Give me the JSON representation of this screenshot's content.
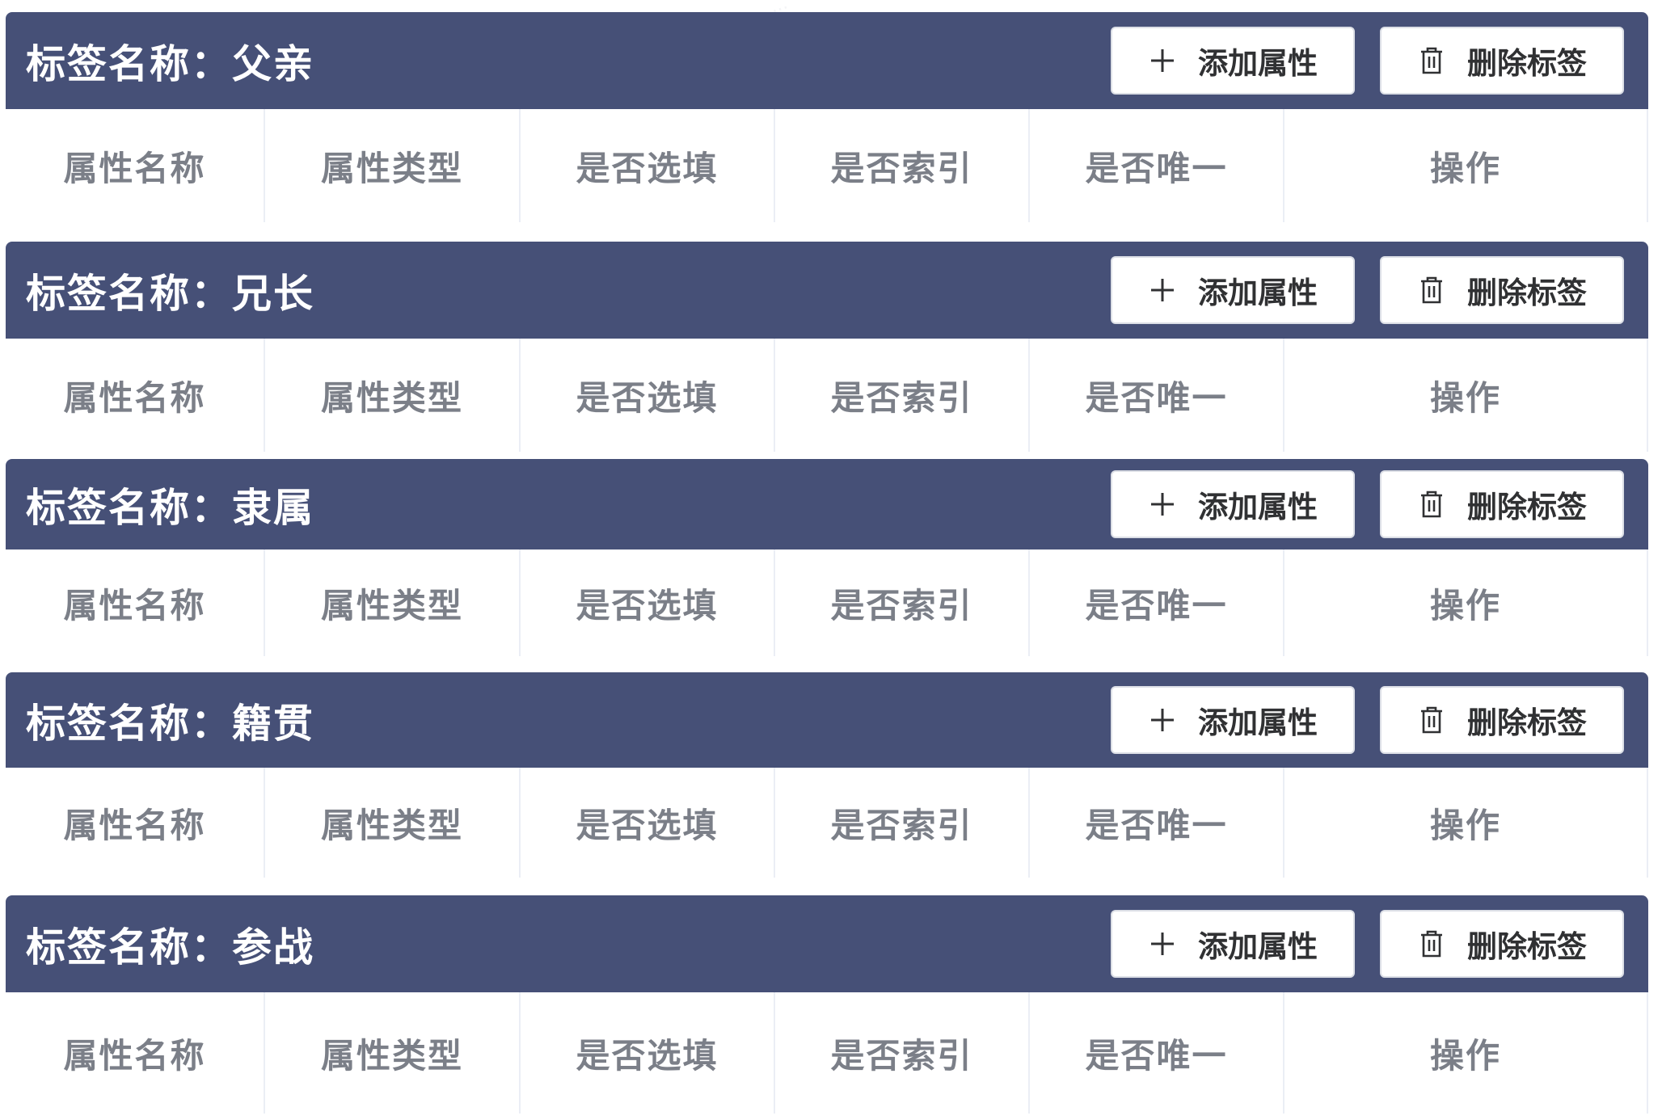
{
  "labels": [
    {
      "title": "标签名称：父亲",
      "add_label": "添加属性",
      "delete_label": "删除标签",
      "columns": [
        "属性名称",
        "属性类型",
        "是否选填",
        "是否索引",
        "是否唯一",
        "操作"
      ]
    },
    {
      "title": "标签名称：兄长",
      "add_label": "添加属性",
      "delete_label": "删除标签",
      "columns": [
        "属性名称",
        "属性类型",
        "是否选填",
        "是否索引",
        "是否唯一",
        "操作"
      ]
    },
    {
      "title": "标签名称：隶属",
      "add_label": "添加属性",
      "delete_label": "删除标签",
      "columns": [
        "属性名称",
        "属性类型",
        "是否选填",
        "是否索引",
        "是否唯一",
        "操作"
      ]
    },
    {
      "title": "标签名称：籍贯",
      "add_label": "添加属性",
      "delete_label": "删除标签",
      "columns": [
        "属性名称",
        "属性类型",
        "是否选填",
        "是否索引",
        "是否唯一",
        "操作"
      ]
    },
    {
      "title": "标签名称：参战",
      "add_label": "添加属性",
      "delete_label": "删除标签",
      "columns": [
        "属性名称",
        "属性类型",
        "是否选填",
        "是否索引",
        "是否唯一",
        "操作"
      ]
    }
  ],
  "icons": {
    "add": "plus-icon",
    "delete": "trash-icon"
  },
  "colors": {
    "header_bg": "#465077",
    "header_text": "#ffffff",
    "column_text": "#7b7f88",
    "button_bg": "#ffffff",
    "button_text": "#303133"
  }
}
